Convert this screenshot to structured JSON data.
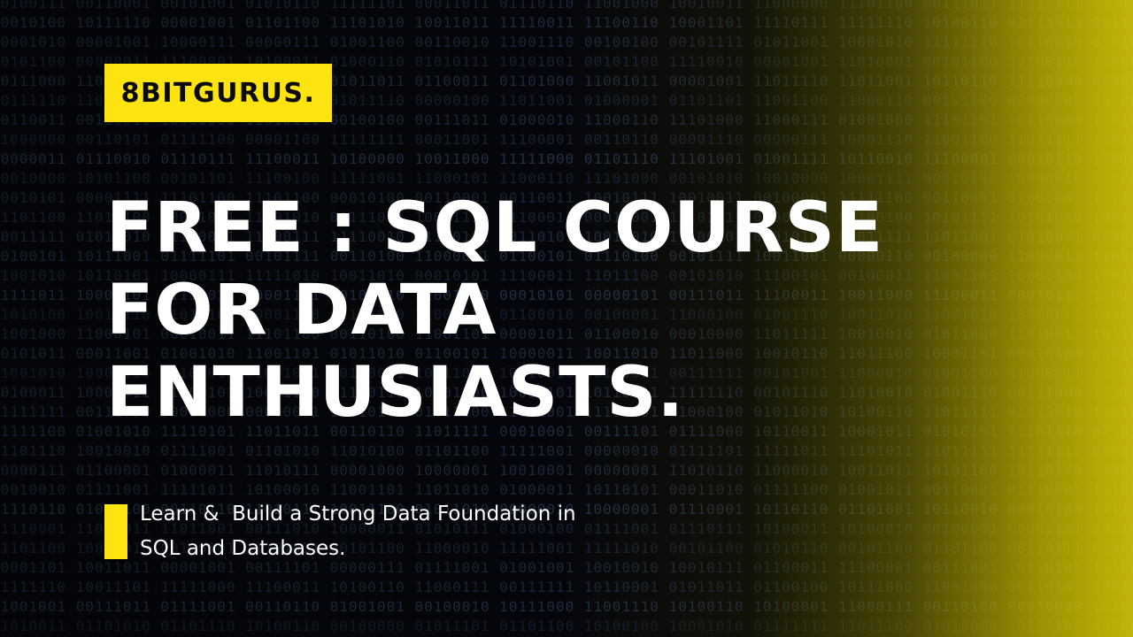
{
  "brand": {
    "logo_text": "8BITGURUS."
  },
  "headline": {
    "lines": [
      "FREE : SQL COURSE",
      "FOR DATA",
      "ENTHUSIASTS."
    ]
  },
  "subtitle": {
    "lines": [
      "Learn &  Build a Strong Data Foundation in",
      "SQL and Databases."
    ]
  },
  "colors": {
    "accent_yellow": "#fde410",
    "background": "#05070c",
    "headline_text": "#ffffff",
    "binary_digits": "#2a3850"
  }
}
